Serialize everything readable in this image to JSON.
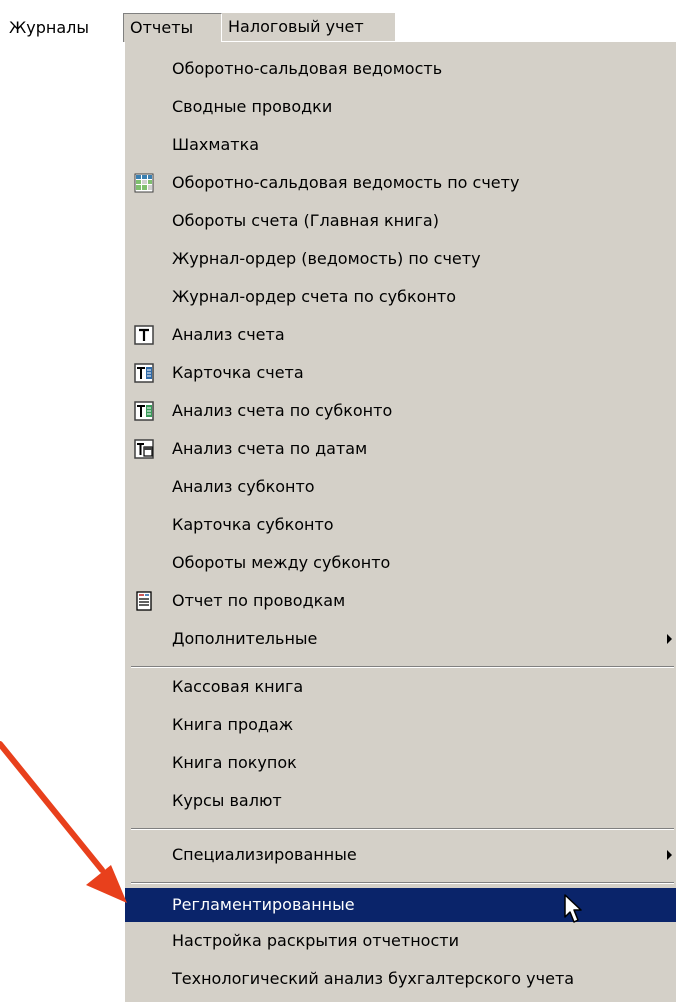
{
  "menubar": {
    "journals": "Журналы",
    "reports": "Отчеты",
    "tax": "Налоговый учет"
  },
  "menu": {
    "items": [
      {
        "label": "Оборотно-сальдовая ведомость"
      },
      {
        "label": "Сводные проводки"
      },
      {
        "label": "Шахматка"
      },
      {
        "label": "Оборотно-сальдовая ведомость по счету",
        "icon": "balance-sheet-icon"
      },
      {
        "label": "Обороты счета (Главная книга)"
      },
      {
        "label": "Журнал-ордер (ведомость) по счету"
      },
      {
        "label": "Журнал-ордер счета по субконто"
      },
      {
        "label": "Анализ счета",
        "icon": "account-analysis-icon"
      },
      {
        "label": "Карточка счета",
        "icon": "account-card-icon"
      },
      {
        "label": "Анализ счета по субконто",
        "icon": "subconto-analysis-icon"
      },
      {
        "label": "Анализ счета по датам",
        "icon": "date-analysis-icon"
      },
      {
        "label": "Анализ субконто"
      },
      {
        "label": "Карточка субконто"
      },
      {
        "label": "Обороты между субконто"
      },
      {
        "label": "Отчет по проводкам",
        "icon": "entries-report-icon"
      },
      {
        "label": "Дополнительные",
        "submenu": true
      },
      {
        "label": "Кассовая книга"
      },
      {
        "label": "Книга продаж"
      },
      {
        "label": "Книга покупок"
      },
      {
        "label": "Курсы валют"
      },
      {
        "label": "Специализированные",
        "submenu": true
      },
      {
        "label": "Регламентированные",
        "selected": true
      },
      {
        "label": "Настройка раскрытия отчетности"
      },
      {
        "label": "Технологический анализ бухгалтерского учета"
      }
    ]
  },
  "colors": {
    "menu_bg": "#d4d0c8",
    "selection": "#0a246a",
    "annotation_arrow": "#e8401c"
  }
}
